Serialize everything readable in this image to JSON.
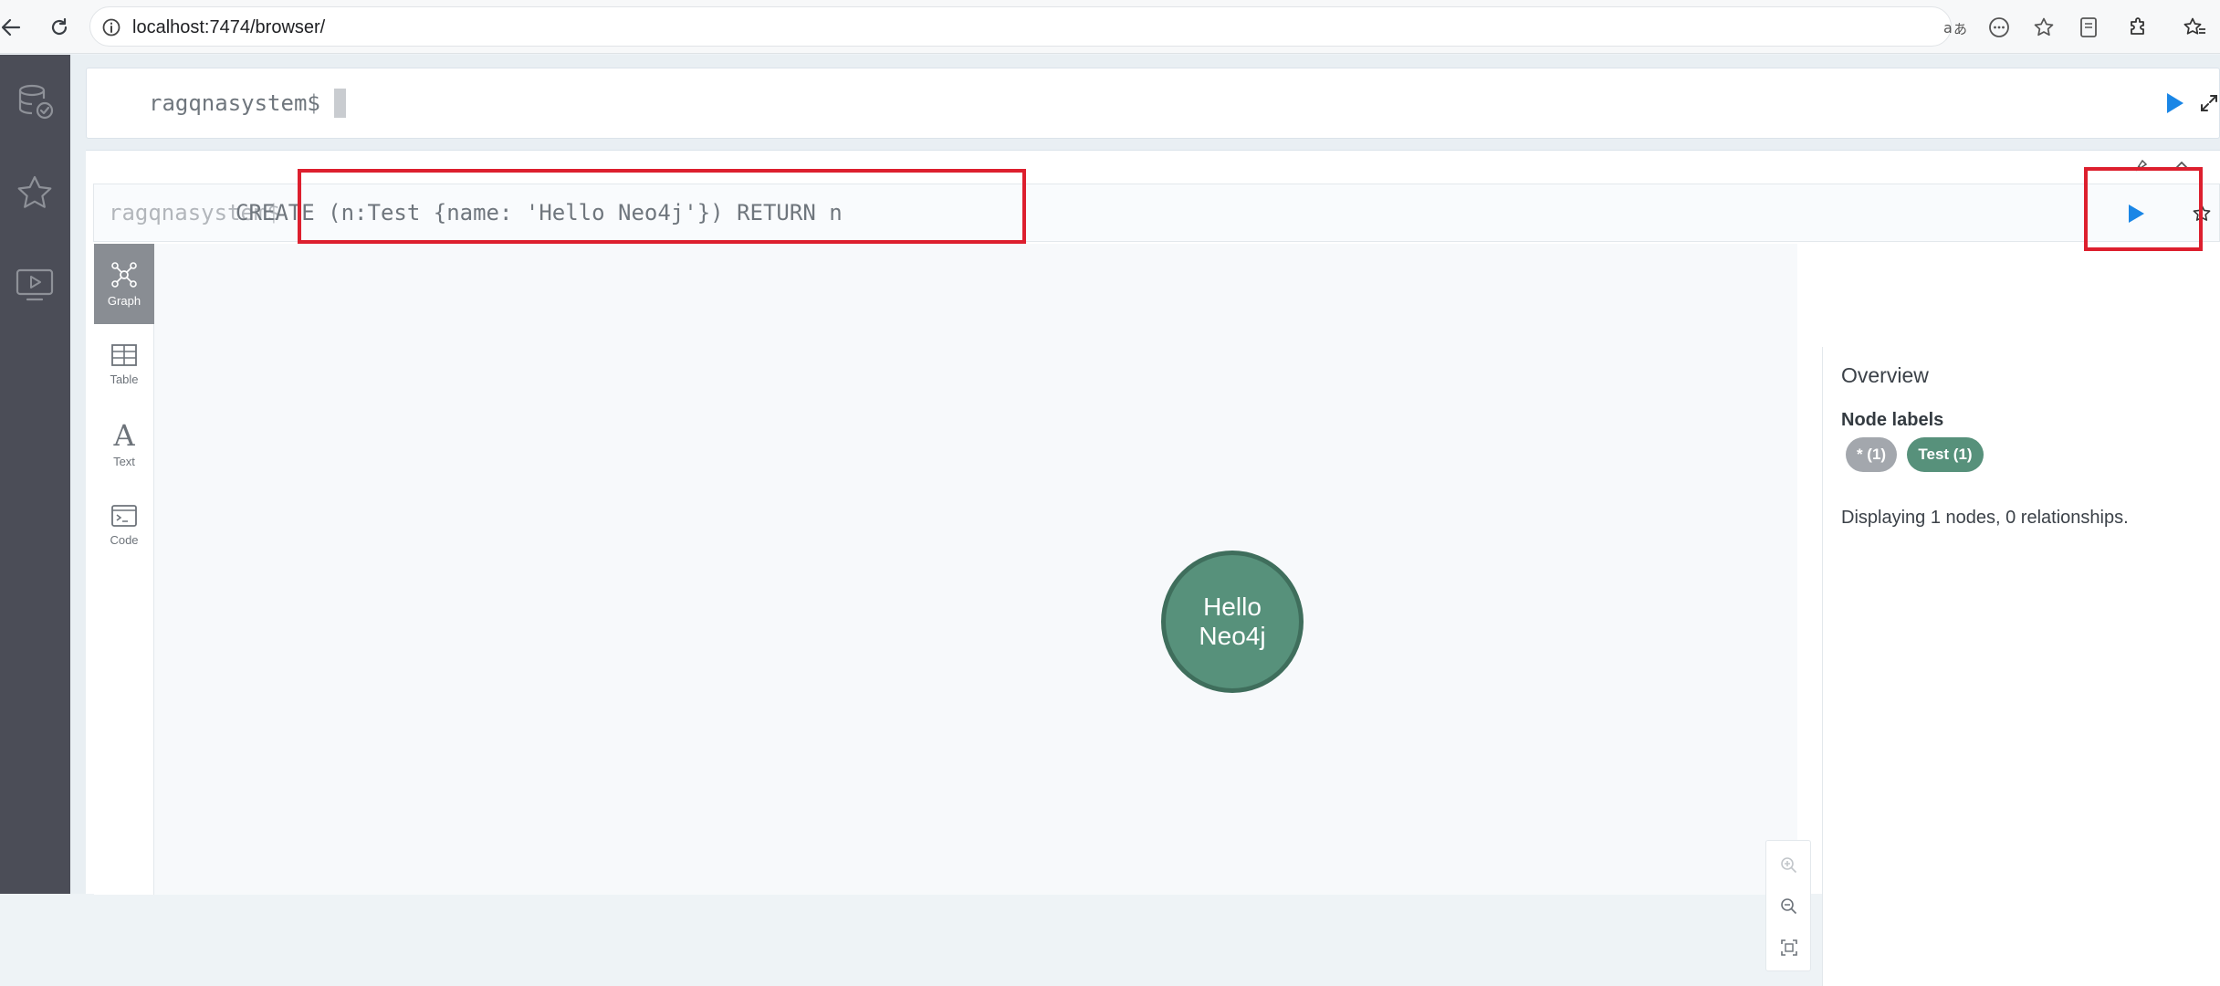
{
  "browser": {
    "url": "localhost:7474/browser/"
  },
  "sidebar": {
    "items": [
      {
        "icon": "database-icon"
      },
      {
        "icon": "favorites-star-icon"
      },
      {
        "icon": "guides-play-icon"
      }
    ]
  },
  "editor": {
    "prompt": "ragqnasystem$",
    "value": ""
  },
  "frame": {
    "prompt": "ragqnasystem$",
    "query": "CREATE (n:Test {name: 'Hello Neo4j'}) RETURN n",
    "views": [
      {
        "label": "Graph",
        "icon": "graph-icon"
      },
      {
        "label": "Table",
        "icon": "table-icon"
      },
      {
        "label": "Text",
        "icon": "text-icon"
      },
      {
        "label": "Code",
        "icon": "code-icon"
      }
    ],
    "node": {
      "caption_line1": "Hello",
      "caption_line2": "Neo4j",
      "color": "#57917b"
    },
    "overview": {
      "title": "Overview",
      "node_labels_heading": "Node labels",
      "chips": [
        {
          "label": "* (1)",
          "color": "#a3a7ad"
        },
        {
          "label": "Test (1)",
          "color": "#57917b"
        }
      ],
      "summary": "Displaying 1 nodes, 0 relationships."
    }
  },
  "colors": {
    "accent_play": "#1a86e6",
    "annotation_red": "#dd1f2e",
    "sidebar_bg": "#4b4d57"
  }
}
